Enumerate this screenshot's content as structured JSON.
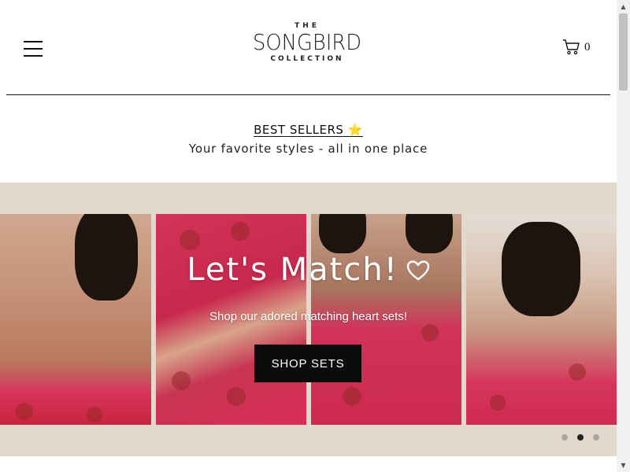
{
  "header": {
    "menu_icon": "hamburger-icon",
    "logo": {
      "top": "THE",
      "main": "SONGBIRD",
      "bottom": "COLLECTION"
    },
    "cart": {
      "icon": "cart-icon",
      "count": "0"
    }
  },
  "promo": {
    "link_label": "BEST SELLERS ⭐",
    "subtitle": "Your favorite styles - all in one place"
  },
  "hero": {
    "title": "Let's Match!",
    "heart_icon": "heart-outline-icon",
    "subtitle": "Shop our adored matching heart sets!",
    "button_label": "SHOP SETS",
    "background_color": "#e2d9cc",
    "slides_total": 3,
    "active_slide": 2
  },
  "colors": {
    "accent_red": "#d4325a",
    "button": "#0b0b0b"
  }
}
